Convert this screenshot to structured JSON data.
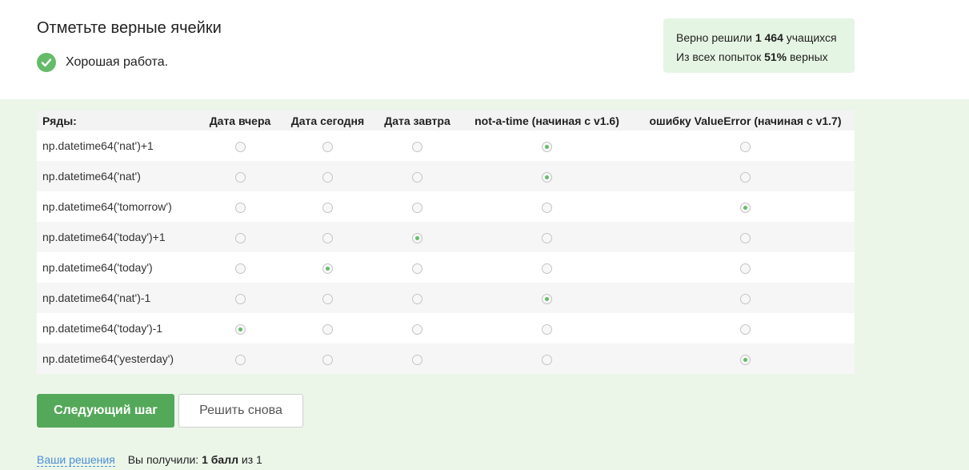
{
  "header": {
    "title": "Отметьте верные ячейки",
    "feedback": "Хорошая работа."
  },
  "stats": {
    "line1_prefix": "Верно решили",
    "line1_count": "1 464",
    "line1_suffix": "учащихся",
    "line2_prefix": "Из всех попыток",
    "line2_percent": "51%",
    "line2_suffix": "верных"
  },
  "grid": {
    "columns": [
      "Ряды:",
      "Дата вчера",
      "Дата сегодня",
      "Дата завтра",
      "not-a-time (начиная с v1.6)",
      "ошибку ValueError (начиная с v1.7)"
    ],
    "rows": [
      {
        "label": "np.datetime64('nat')+1",
        "selected": 3
      },
      {
        "label": "np.datetime64('nat')",
        "selected": 3
      },
      {
        "label": "np.datetime64('tomorrow')",
        "selected": 4
      },
      {
        "label": "np.datetime64('today')+1",
        "selected": 2
      },
      {
        "label": "np.datetime64('today')",
        "selected": 1
      },
      {
        "label": "np.datetime64('nat')-1",
        "selected": 3
      },
      {
        "label": "np.datetime64('today')-1",
        "selected": 0
      },
      {
        "label": "np.datetime64('yesterday')",
        "selected": 4
      }
    ]
  },
  "actions": {
    "next_label": "Следующий шаг",
    "retry_label": "Решить снова"
  },
  "footer": {
    "solutions_link": "Ваши решения",
    "result_prefix": "Вы получили:",
    "result_score": "1 балл",
    "result_suffix": "из 1"
  },
  "colors": {
    "accent": "#54a859",
    "panel_bg": "#ebf6e9",
    "stats_bg": "#e5f5e3",
    "link": "#4d8fd6"
  },
  "icons": {
    "feedback": "check-circle-icon"
  }
}
